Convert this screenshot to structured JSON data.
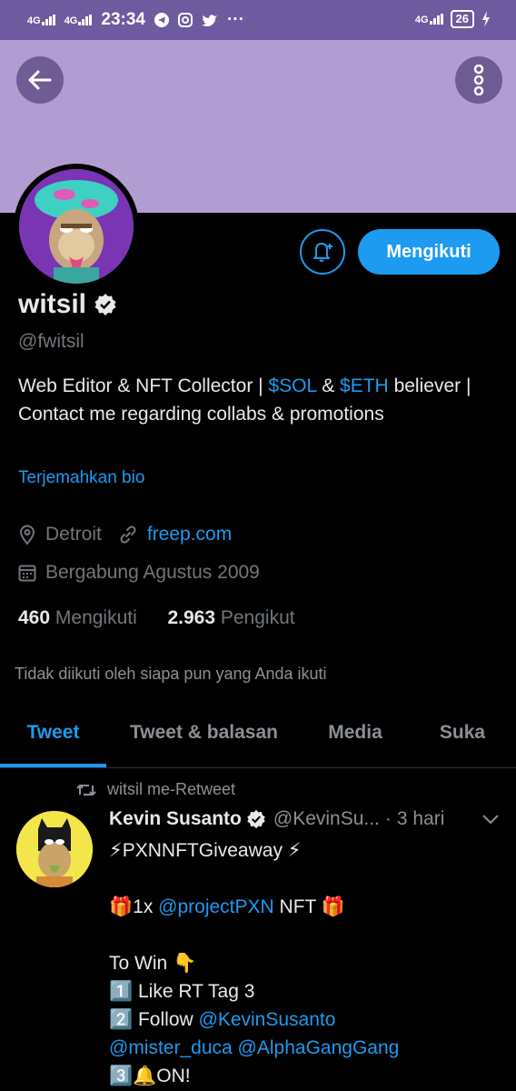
{
  "status_bar": {
    "network_left_1": "4G",
    "network_left_2": "4G",
    "time": "23:34",
    "more": "···",
    "network_right": "4G",
    "battery": "26"
  },
  "profile": {
    "name": "witsil",
    "handle": "@fwitsil",
    "bio_part1": "Web Editor & NFT Collector | ",
    "bio_sol": "$SOL",
    "bio_and": " & ",
    "bio_eth": "$ETH",
    "bio_part2": " believer | Contact me regarding collabs & promotions",
    "translate_bio": "Terjemahkan bio",
    "location": "Detroit",
    "website": "freep.com",
    "joined": "Bergabung Agustus 2009",
    "following_count": "460",
    "following_label": "Mengikuti",
    "followers_count": "2.963",
    "followers_label": "Pengikut",
    "not_followed": "Tidak diikuti oleh siapa pun yang Anda ikuti",
    "follow_button": "Mengikuti"
  },
  "tabs": [
    {
      "label": "Tweet",
      "active": true
    },
    {
      "label": "Tweet & balasan",
      "active": false
    },
    {
      "label": "Media",
      "active": false
    },
    {
      "label": "Suka",
      "active": false
    }
  ],
  "tweet": {
    "retweeted_by": "witsil me-Retweet",
    "author_name": "Kevin Susanto",
    "author_handle": "@KevinSu...",
    "time_sep": "·",
    "time": "3 hari",
    "line1": "⚡PXNNFTGiveaway ⚡",
    "line2_pre": "🎁1x ",
    "line2_mention": "@projectPXN",
    "line2_post": " NFT 🎁",
    "line3": "To Win 👇",
    "line4": "1️⃣ Like RT Tag 3",
    "line5_pre": "2️⃣ Follow ",
    "line5_mention": "@KevinSusanto",
    "line6_mention1": "@mister_duca",
    "line6_space": " ",
    "line6_mention2": "@AlphaGangGang",
    "line7": "3️⃣🔔ON!"
  },
  "colors": {
    "accent": "#1d9bf0",
    "banner": "#b29dd3",
    "status_bar": "#6e5a9e",
    "background": "#000000"
  },
  "icons": [
    "back-arrow-icon",
    "more-vertical-icon",
    "bell-plus-icon",
    "verified-badge-icon",
    "location-pin-icon",
    "link-icon",
    "calendar-icon",
    "retweet-icon",
    "chevron-down-icon",
    "telegram-icon",
    "instagram-icon",
    "twitter-icon",
    "charging-icon"
  ]
}
